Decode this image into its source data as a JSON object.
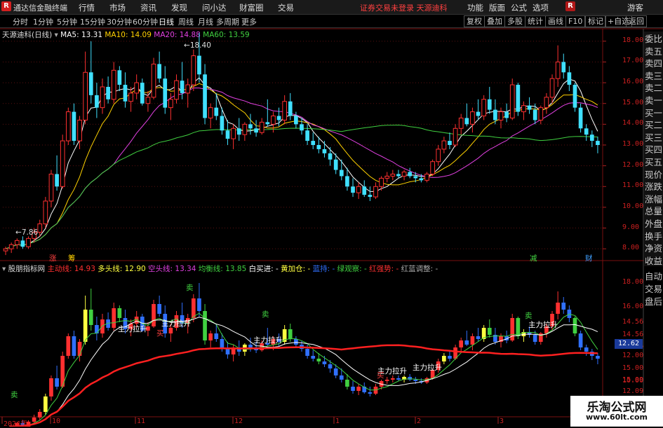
{
  "app": {
    "logo": "R",
    "title": "通达信金融终端"
  },
  "menu": [
    "行情",
    "市场",
    "资讯",
    "发现",
    "问小达",
    "财富圈",
    "交易"
  ],
  "notice": "证券交易未登录  天源迪科",
  "right_menu": [
    "功能",
    "版面",
    "公式",
    "选项"
  ],
  "top_right": {
    "badge": "R",
    "guest": "游客"
  },
  "periods": [
    "分时",
    "1分钟",
    "5分钟",
    "15分钟",
    "30分钟",
    "60分钟",
    "日线",
    "周线",
    "月线",
    "多周期",
    "更多"
  ],
  "active_period": "日线",
  "tools": [
    "复权",
    "叠加",
    "多股",
    "统计",
    "画线",
    "F10",
    "标记",
    "+自选",
    "返回"
  ],
  "stock": {
    "name": "天源迪科",
    "period_label": "(日线)"
  },
  "ma": [
    {
      "label": "MA5: 13.31",
      "color": "#ffffff"
    },
    {
      "label": "MA10: 14.09",
      "color": "#ffd200"
    },
    {
      "label": "MA20: 14.88",
      "color": "#e040e0"
    },
    {
      "label": "MA60: 13.59",
      "color": "#40d040"
    }
  ],
  "price_labels": {
    "high": "18.40",
    "low": "7.86"
  },
  "price_axis": [
    "18.00",
    "17.00",
    "16.00",
    "15.00",
    "14.00",
    "13.00",
    "12.00",
    "11.00",
    "10.00",
    "9.00",
    "8.00"
  ],
  "markers": {
    "zhang": "涨",
    "ting": "筹",
    "jian": "减",
    "cai": "财"
  },
  "sidebar_upper": [
    "委比",
    "卖五",
    "卖四",
    "卖三",
    "卖二",
    "卖一",
    "买一",
    "买二",
    "买三",
    "买四",
    "买五",
    "现价",
    "涨跌",
    "涨幅",
    "总量",
    "外盘",
    "换手",
    "净资",
    "收益"
  ],
  "sidebar_lower": [
    "自动",
    "交易",
    "盘后"
  ],
  "indicator": {
    "name": "股朋指标网",
    "items": [
      {
        "label": "主动线: 14.93",
        "color": "#ff3030"
      },
      {
        "label": "多头线: 12.90",
        "color": "#ffff40"
      },
      {
        "label": "空头线: 13.34",
        "color": "#e040e0"
      },
      {
        "label": "均衡线: 13.85",
        "color": "#40d040"
      },
      {
        "label": "白买进: -",
        "color": "#ffffff"
      },
      {
        "label": "黄加仓: -",
        "color": "#ffff40"
      },
      {
        "label": "蓝持: -",
        "color": "#3070ff"
      },
      {
        "label": "绿观察: -",
        "color": "#40d040"
      },
      {
        "label": "红强势: -",
        "color": "#ff3030"
      },
      {
        "label": "红蓝调整: -",
        "color": "#aaaaaa"
      }
    ]
  },
  "lower_axis": [
    "18.00",
    "16.00",
    "14.56",
    "14.56",
    "14.56",
    "12.00",
    "15.00",
    "15.09",
    "10.00",
    "12.09"
  ],
  "current_value": "12.62",
  "signals": {
    "label_lift": "主力拉升",
    "label_buy": "买",
    "label_sell": "卖"
  },
  "x_axis": [
    "2024年",
    "10",
    "11",
    "12",
    "1",
    "2",
    "3"
  ],
  "watermark": {
    "line1": "乐淘公式网",
    "line2": "www.60lt.com"
  },
  "chart_data": {
    "type": "candlestick",
    "ylim": [
      7.5,
      18.5
    ],
    "ohlc": [
      [
        7.9,
        8.1,
        7.7,
        8.0
      ],
      [
        8.0,
        8.3,
        7.8,
        8.2
      ],
      [
        8.2,
        8.5,
        8.0,
        8.4
      ],
      [
        8.4,
        8.6,
        8.0,
        8.1
      ],
      [
        8.1,
        8.6,
        8.0,
        8.5
      ],
      [
        8.5,
        9.0,
        8.3,
        8.8
      ],
      [
        8.8,
        9.4,
        8.6,
        9.2
      ],
      [
        9.2,
        10.5,
        9.0,
        10.3
      ],
      [
        10.3,
        11.8,
        10.0,
        11.6
      ],
      [
        11.6,
        12.5,
        10.8,
        11.0
      ],
      [
        11.0,
        13.5,
        10.9,
        13.2
      ],
      [
        13.2,
        14.8,
        13.0,
        14.6
      ],
      [
        14.6,
        15.0,
        13.0,
        13.2
      ],
      [
        13.2,
        14.4,
        12.8,
        14.2
      ],
      [
        14.2,
        17.5,
        14.0,
        16.5
      ],
      [
        16.5,
        18.0,
        15.0,
        15.4
      ],
      [
        15.4,
        16.0,
        14.3,
        14.8
      ],
      [
        14.8,
        16.2,
        14.5,
        15.8
      ],
      [
        15.8,
        16.3,
        15.0,
        15.2
      ],
      [
        15.2,
        17.0,
        15.0,
        16.6
      ],
      [
        16.6,
        16.8,
        15.6,
        15.9
      ],
      [
        15.9,
        16.5,
        14.8,
        15.1
      ],
      [
        15.1,
        15.8,
        14.6,
        15.5
      ],
      [
        15.5,
        16.4,
        15.2,
        16.0
      ],
      [
        16.0,
        16.2,
        14.9,
        15.0
      ],
      [
        15.0,
        15.6,
        14.6,
        15.3
      ],
      [
        15.3,
        17.2,
        15.2,
        16.9
      ],
      [
        16.9,
        17.5,
        16.0,
        16.2
      ],
      [
        16.2,
        16.8,
        14.5,
        14.8
      ],
      [
        14.8,
        15.5,
        14.2,
        15.2
      ],
      [
        15.2,
        16.4,
        15.0,
        16.1
      ],
      [
        16.1,
        17.0,
        15.2,
        15.5
      ],
      [
        15.5,
        16.2,
        14.8,
        15.9
      ],
      [
        15.9,
        17.6,
        15.6,
        17.3
      ],
      [
        17.3,
        18.4,
        16.0,
        16.4
      ],
      [
        16.4,
        16.9,
        14.0,
        14.3
      ],
      [
        14.3,
        15.0,
        13.8,
        14.8
      ],
      [
        14.8,
        15.5,
        14.2,
        14.4
      ],
      [
        14.4,
        14.8,
        13.5,
        13.7
      ],
      [
        13.7,
        14.2,
        13.0,
        13.3
      ],
      [
        13.3,
        14.0,
        12.8,
        13.8
      ],
      [
        13.8,
        14.3,
        13.2,
        13.5
      ],
      [
        13.5,
        14.1,
        13.2,
        14.0
      ],
      [
        14.0,
        14.5,
        13.5,
        13.8
      ],
      [
        13.8,
        14.2,
        13.4,
        13.6
      ],
      [
        13.6,
        14.3,
        13.5,
        14.1
      ],
      [
        14.1,
        15.2,
        13.9,
        14.0
      ],
      [
        14.0,
        14.6,
        13.6,
        14.4
      ],
      [
        14.4,
        14.8,
        13.9,
        14.2
      ],
      [
        14.2,
        15.4,
        14.0,
        15.1
      ],
      [
        15.1,
        15.5,
        14.2,
        14.4
      ],
      [
        14.4,
        14.6,
        13.8,
        14.0
      ],
      [
        14.0,
        14.3,
        13.5,
        13.7
      ],
      [
        13.7,
        14.0,
        13.0,
        13.2
      ],
      [
        13.2,
        13.6,
        12.8,
        13.0
      ],
      [
        13.0,
        13.4,
        12.6,
        12.8
      ],
      [
        12.8,
        13.2,
        12.4,
        12.6
      ],
      [
        12.6,
        12.9,
        12.0,
        12.3
      ],
      [
        12.3,
        12.6,
        11.6,
        11.8
      ],
      [
        11.8,
        12.3,
        11.3,
        11.5
      ],
      [
        11.5,
        11.9,
        10.8,
        11.0
      ],
      [
        11.0,
        11.4,
        10.5,
        10.7
      ],
      [
        10.7,
        11.2,
        10.4,
        11.0
      ],
      [
        11.0,
        11.3,
        10.5,
        10.6
      ],
      [
        10.6,
        11.0,
        10.3,
        10.5
      ],
      [
        10.5,
        11.2,
        10.4,
        11.0
      ],
      [
        11.0,
        11.5,
        10.8,
        11.4
      ],
      [
        11.4,
        11.7,
        11.2,
        11.5
      ],
      [
        11.5,
        11.8,
        11.3,
        11.6
      ],
      [
        11.6,
        11.8,
        11.4,
        11.5
      ],
      [
        11.5,
        11.8,
        11.3,
        11.7
      ],
      [
        11.7,
        11.9,
        11.4,
        11.5
      ],
      [
        11.5,
        11.7,
        11.2,
        11.4
      ],
      [
        11.4,
        11.6,
        11.2,
        11.3
      ],
      [
        11.3,
        11.7,
        11.2,
        11.6
      ],
      [
        11.6,
        12.3,
        11.5,
        12.2
      ],
      [
        12.2,
        13.0,
        12.0,
        12.8
      ],
      [
        12.8,
        13.4,
        12.6,
        13.2
      ],
      [
        13.2,
        13.6,
        12.8,
        13.0
      ],
      [
        13.0,
        14.0,
        12.9,
        13.8
      ],
      [
        13.8,
        14.5,
        13.5,
        14.3
      ],
      [
        14.3,
        15.0,
        13.9,
        14.0
      ],
      [
        14.0,
        14.8,
        13.6,
        14.6
      ],
      [
        14.6,
        15.2,
        14.2,
        14.4
      ],
      [
        14.4,
        15.4,
        14.2,
        15.2
      ],
      [
        15.2,
        15.8,
        14.5,
        14.7
      ],
      [
        14.7,
        15.2,
        14.0,
        14.2
      ],
      [
        14.2,
        14.8,
        13.8,
        14.6
      ],
      [
        14.6,
        15.0,
        14.1,
        14.3
      ],
      [
        14.3,
        16.2,
        14.2,
        15.9
      ],
      [
        15.9,
        16.0,
        14.4,
        14.6
      ],
      [
        14.6,
        15.1,
        14.2,
        14.9
      ],
      [
        14.9,
        15.3,
        14.5,
        14.7
      ],
      [
        14.7,
        15.0,
        14.0,
        14.2
      ],
      [
        14.2,
        14.9,
        14.0,
        14.8
      ],
      [
        14.8,
        15.5,
        14.5,
        15.3
      ],
      [
        15.3,
        16.4,
        15.0,
        16.2
      ],
      [
        16.2,
        17.8,
        15.8,
        17.0
      ],
      [
        17.0,
        17.4,
        16.2,
        16.5
      ],
      [
        16.5,
        16.8,
        15.6,
        15.9
      ],
      [
        15.9,
        16.0,
        14.6,
        14.8
      ],
      [
        14.8,
        15.0,
        13.6,
        13.8
      ],
      [
        13.8,
        14.0,
        13.2,
        13.5
      ],
      [
        13.5,
        13.7,
        12.9,
        13.2
      ],
      [
        13.2,
        13.4,
        12.6,
        13.0
      ]
    ],
    "ma_series": [
      "MA5",
      "MA10",
      "MA20",
      "MA60"
    ]
  }
}
